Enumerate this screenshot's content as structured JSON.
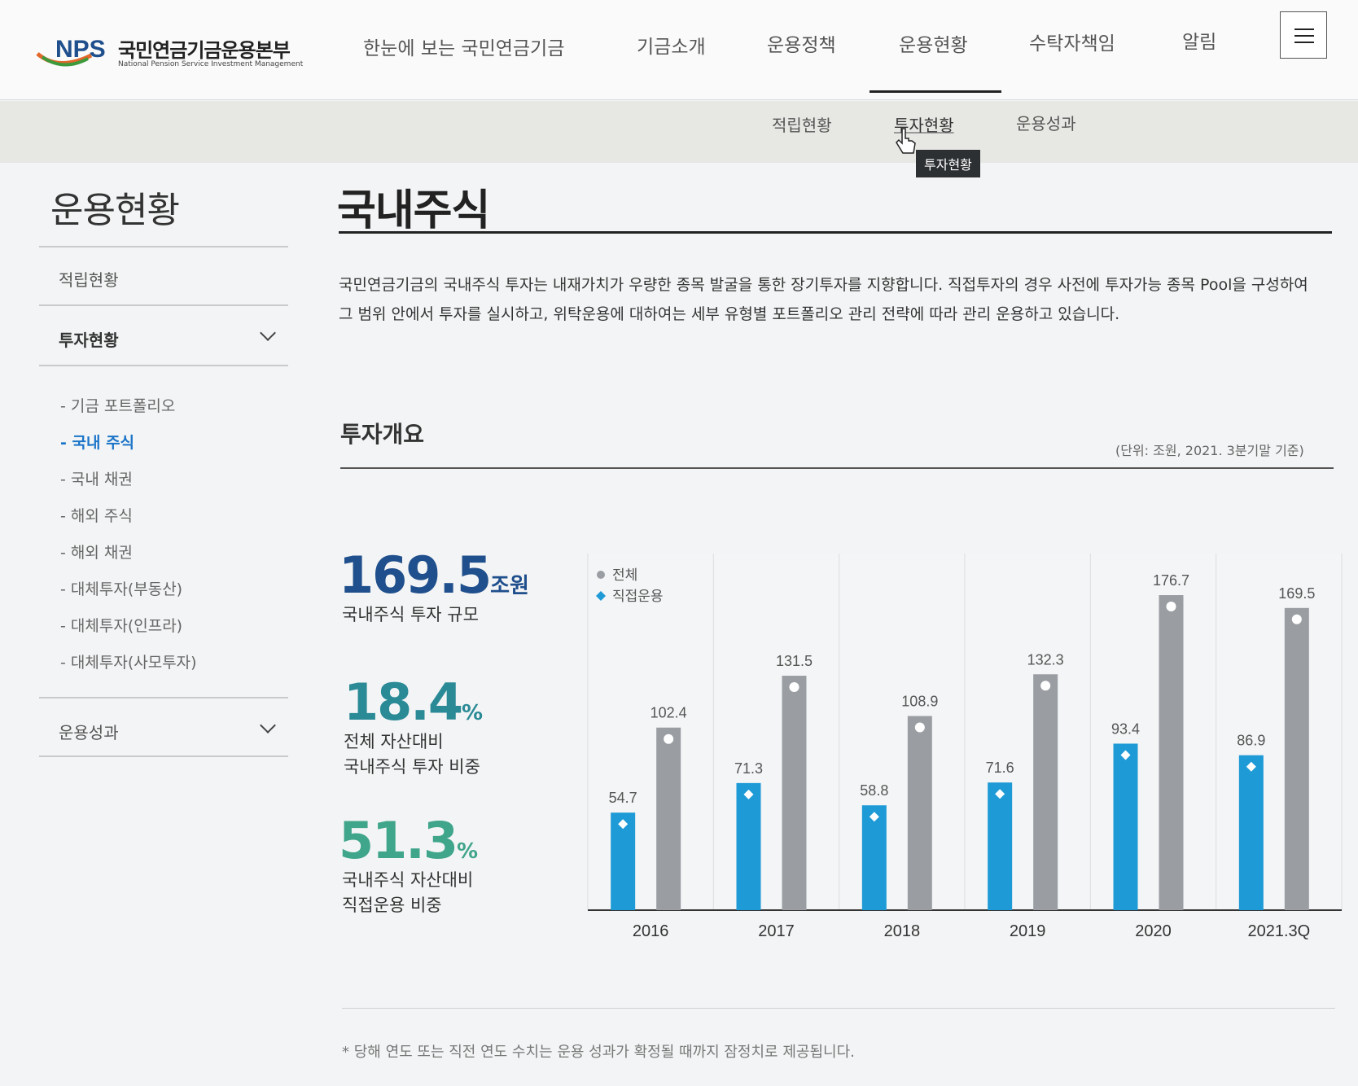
{
  "header": {
    "logo_text": "NPS",
    "logo_title": "국민연금기금운용본부",
    "logo_subtitle": "National Pension Service Investment Management",
    "nav": [
      "한눈에 보는 국민연금기금",
      "기금소개",
      "운용정책",
      "운용현황",
      "수탁자책임",
      "알림"
    ],
    "active_nav": "운용현황"
  },
  "subnav": {
    "items": [
      "적립현황",
      "투자현황",
      "운용성과"
    ],
    "active": "투자현황",
    "tooltip": "투자현황"
  },
  "sidebar": {
    "title": "운용현황",
    "items": [
      {
        "label": "적립현황"
      },
      {
        "label": "투자현황",
        "expanded": true
      },
      {
        "label": "운용성과"
      }
    ],
    "subitems": [
      "- 기금 포트폴리오",
      "- 국내 주식",
      "- 국내 채권",
      "- 해외 주식",
      "- 해외 채권",
      "- 대체투자(부동산)",
      "- 대체투자(인프라)",
      "- 대체투자(사모투자)"
    ],
    "active_subitem": "- 국내 주식"
  },
  "main": {
    "title": "국내주식",
    "description": "국민연금기금의 국내주식 투자는 내재가치가 우량한 종목 발굴을 통한 장기투자를 지향합니다. 직접투자의 경우 사전에 투자가능 종목 Pool을 구성하여 그 범위 안에서 투자를 실시하고, 위탁운용에 대하여는 세부 유형별 포트폴리오 관리 전략에 따라 관리 운용하고 있습니다.",
    "section_title": "투자개요",
    "unit_note": "(단위: 조원, 2021. 3분기말 기준)",
    "stats": [
      {
        "value": "169.5",
        "unit": "조원",
        "label_lines": [
          "국내주식 투자 규모"
        ],
        "color": "#1f4f8c"
      },
      {
        "value": "18.4",
        "unit": "%",
        "label_lines": [
          "전체 자산대비",
          "국내주식 투자 비중"
        ],
        "color": "#2a8a96"
      },
      {
        "value": "51.3",
        "unit": "%",
        "label_lines": [
          "국내주식 자산대비",
          "직접운용 비중"
        ],
        "color": "#3fa58b"
      }
    ],
    "footnote": "* 당해 연도 또는 직전 연도 수치는 운용 성과가 확정될 때까지 잠정치로 제공됩니다."
  },
  "colors": {
    "direct": "#1e9ad6",
    "total": "#9a9ea3",
    "active_link": "#1a74c8"
  },
  "chart_data": {
    "type": "bar",
    "categories": [
      "2016",
      "2017",
      "2018",
      "2019",
      "2020",
      "2021.3Q"
    ],
    "series": [
      {
        "name": "직접운용",
        "values": [
          54.7,
          71.3,
          58.8,
          71.6,
          93.4,
          86.9
        ]
      },
      {
        "name": "전체",
        "values": [
          102.4,
          131.5,
          108.9,
          132.3,
          176.7,
          169.5
        ]
      }
    ],
    "legend": [
      "전체",
      "직접운용"
    ],
    "legend_position": "top-left",
    "ylim": [
      0,
      200
    ],
    "grid": "vertical",
    "data_labels": true
  }
}
